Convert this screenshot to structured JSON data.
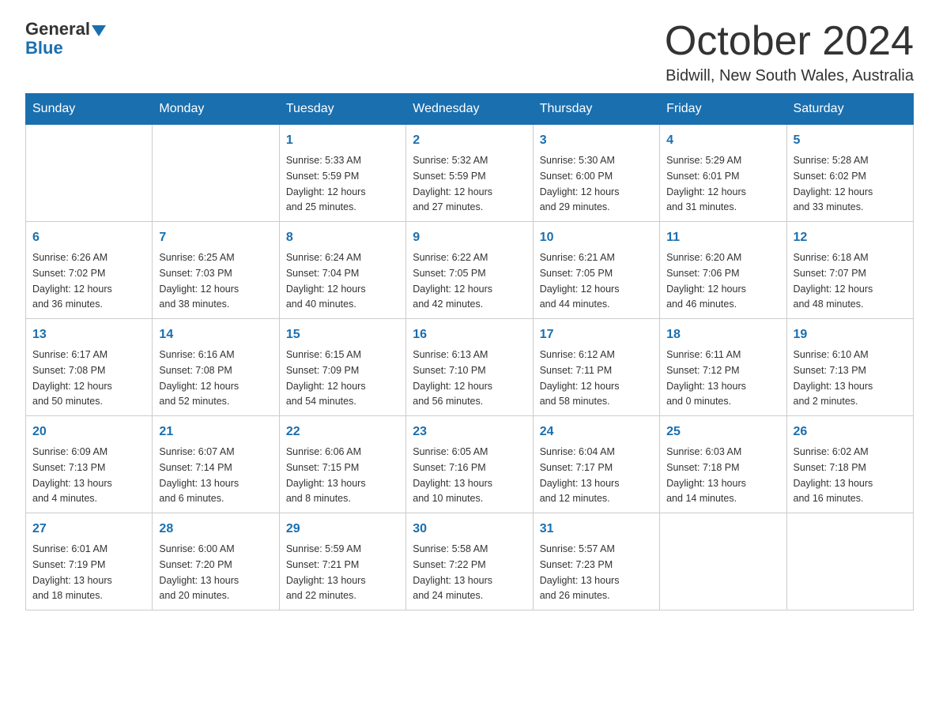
{
  "header": {
    "logo_general": "General",
    "logo_blue": "Blue",
    "title": "October 2024",
    "subtitle": "Bidwill, New South Wales, Australia"
  },
  "calendar": {
    "days_of_week": [
      "Sunday",
      "Monday",
      "Tuesday",
      "Wednesday",
      "Thursday",
      "Friday",
      "Saturday"
    ],
    "weeks": [
      [
        {
          "day": "",
          "info": ""
        },
        {
          "day": "",
          "info": ""
        },
        {
          "day": "1",
          "info": "Sunrise: 5:33 AM\nSunset: 5:59 PM\nDaylight: 12 hours\nand 25 minutes."
        },
        {
          "day": "2",
          "info": "Sunrise: 5:32 AM\nSunset: 5:59 PM\nDaylight: 12 hours\nand 27 minutes."
        },
        {
          "day": "3",
          "info": "Sunrise: 5:30 AM\nSunset: 6:00 PM\nDaylight: 12 hours\nand 29 minutes."
        },
        {
          "day": "4",
          "info": "Sunrise: 5:29 AM\nSunset: 6:01 PM\nDaylight: 12 hours\nand 31 minutes."
        },
        {
          "day": "5",
          "info": "Sunrise: 5:28 AM\nSunset: 6:02 PM\nDaylight: 12 hours\nand 33 minutes."
        }
      ],
      [
        {
          "day": "6",
          "info": "Sunrise: 6:26 AM\nSunset: 7:02 PM\nDaylight: 12 hours\nand 36 minutes."
        },
        {
          "day": "7",
          "info": "Sunrise: 6:25 AM\nSunset: 7:03 PM\nDaylight: 12 hours\nand 38 minutes."
        },
        {
          "day": "8",
          "info": "Sunrise: 6:24 AM\nSunset: 7:04 PM\nDaylight: 12 hours\nand 40 minutes."
        },
        {
          "day": "9",
          "info": "Sunrise: 6:22 AM\nSunset: 7:05 PM\nDaylight: 12 hours\nand 42 minutes."
        },
        {
          "day": "10",
          "info": "Sunrise: 6:21 AM\nSunset: 7:05 PM\nDaylight: 12 hours\nand 44 minutes."
        },
        {
          "day": "11",
          "info": "Sunrise: 6:20 AM\nSunset: 7:06 PM\nDaylight: 12 hours\nand 46 minutes."
        },
        {
          "day": "12",
          "info": "Sunrise: 6:18 AM\nSunset: 7:07 PM\nDaylight: 12 hours\nand 48 minutes."
        }
      ],
      [
        {
          "day": "13",
          "info": "Sunrise: 6:17 AM\nSunset: 7:08 PM\nDaylight: 12 hours\nand 50 minutes."
        },
        {
          "day": "14",
          "info": "Sunrise: 6:16 AM\nSunset: 7:08 PM\nDaylight: 12 hours\nand 52 minutes."
        },
        {
          "day": "15",
          "info": "Sunrise: 6:15 AM\nSunset: 7:09 PM\nDaylight: 12 hours\nand 54 minutes."
        },
        {
          "day": "16",
          "info": "Sunrise: 6:13 AM\nSunset: 7:10 PM\nDaylight: 12 hours\nand 56 minutes."
        },
        {
          "day": "17",
          "info": "Sunrise: 6:12 AM\nSunset: 7:11 PM\nDaylight: 12 hours\nand 58 minutes."
        },
        {
          "day": "18",
          "info": "Sunrise: 6:11 AM\nSunset: 7:12 PM\nDaylight: 13 hours\nand 0 minutes."
        },
        {
          "day": "19",
          "info": "Sunrise: 6:10 AM\nSunset: 7:13 PM\nDaylight: 13 hours\nand 2 minutes."
        }
      ],
      [
        {
          "day": "20",
          "info": "Sunrise: 6:09 AM\nSunset: 7:13 PM\nDaylight: 13 hours\nand 4 minutes."
        },
        {
          "day": "21",
          "info": "Sunrise: 6:07 AM\nSunset: 7:14 PM\nDaylight: 13 hours\nand 6 minutes."
        },
        {
          "day": "22",
          "info": "Sunrise: 6:06 AM\nSunset: 7:15 PM\nDaylight: 13 hours\nand 8 minutes."
        },
        {
          "day": "23",
          "info": "Sunrise: 6:05 AM\nSunset: 7:16 PM\nDaylight: 13 hours\nand 10 minutes."
        },
        {
          "day": "24",
          "info": "Sunrise: 6:04 AM\nSunset: 7:17 PM\nDaylight: 13 hours\nand 12 minutes."
        },
        {
          "day": "25",
          "info": "Sunrise: 6:03 AM\nSunset: 7:18 PM\nDaylight: 13 hours\nand 14 minutes."
        },
        {
          "day": "26",
          "info": "Sunrise: 6:02 AM\nSunset: 7:18 PM\nDaylight: 13 hours\nand 16 minutes."
        }
      ],
      [
        {
          "day": "27",
          "info": "Sunrise: 6:01 AM\nSunset: 7:19 PM\nDaylight: 13 hours\nand 18 minutes."
        },
        {
          "day": "28",
          "info": "Sunrise: 6:00 AM\nSunset: 7:20 PM\nDaylight: 13 hours\nand 20 minutes."
        },
        {
          "day": "29",
          "info": "Sunrise: 5:59 AM\nSunset: 7:21 PM\nDaylight: 13 hours\nand 22 minutes."
        },
        {
          "day": "30",
          "info": "Sunrise: 5:58 AM\nSunset: 7:22 PM\nDaylight: 13 hours\nand 24 minutes."
        },
        {
          "day": "31",
          "info": "Sunrise: 5:57 AM\nSunset: 7:23 PM\nDaylight: 13 hours\nand 26 minutes."
        },
        {
          "day": "",
          "info": ""
        },
        {
          "day": "",
          "info": ""
        }
      ]
    ]
  }
}
